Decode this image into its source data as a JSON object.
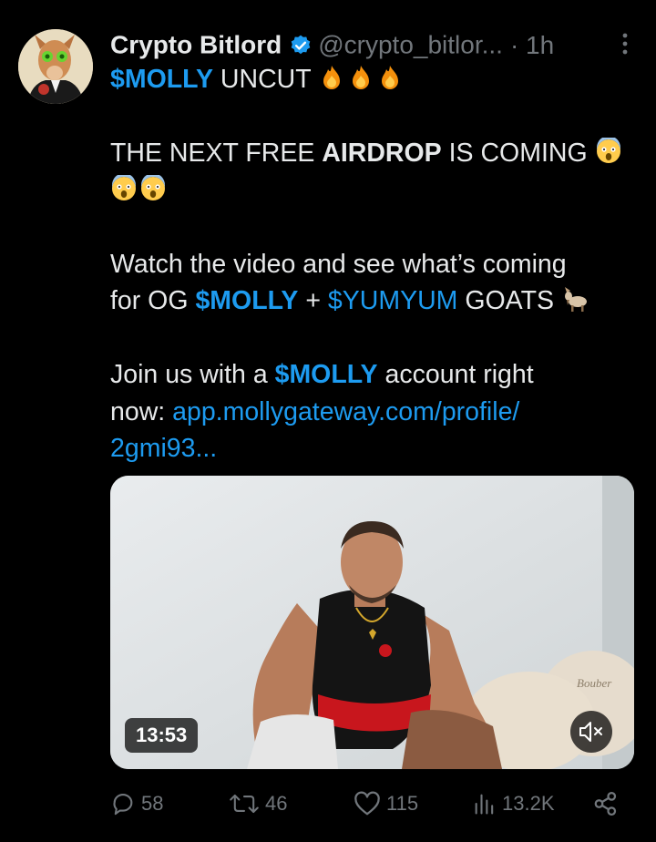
{
  "tweet": {
    "author": {
      "name": "Crypto Bitlord",
      "handle": "@crypto_bitlor...",
      "time": "· 1h",
      "avatar_icon": "goat-avatar"
    },
    "text": {
      "l1_ticker": "$MOLLY",
      "l1_rest": " UNCUT ",
      "l3_a": "THE NEXT FREE ",
      "l3_b": "AIRDROP",
      "l3_c": " IS COMING ",
      "l6": "Watch the video and see what’s coming",
      "l7_a": "for OG ",
      "l7_b": "$MOLLY",
      "l7_c": " + ",
      "l7_d": "$YUMYUM",
      "l7_e": " GOATS ",
      "l9_a": "Join us with a ",
      "l9_b": "$MOLLY",
      "l9_c": " account right",
      "l10_a": "now: ",
      "l10_b": "app.mollygateway.com/profile/",
      "l11": "2gmi93..."
    },
    "media": {
      "duration": "13:53",
      "ball_text": "Bouber"
    },
    "actions": {
      "replies": "58",
      "reposts": "46",
      "likes": "115",
      "views": "13.2K"
    },
    "colors": {
      "background": "#000000",
      "text": "#e7e9ea",
      "muted": "#71767b",
      "link": "#1d9bf0"
    }
  }
}
